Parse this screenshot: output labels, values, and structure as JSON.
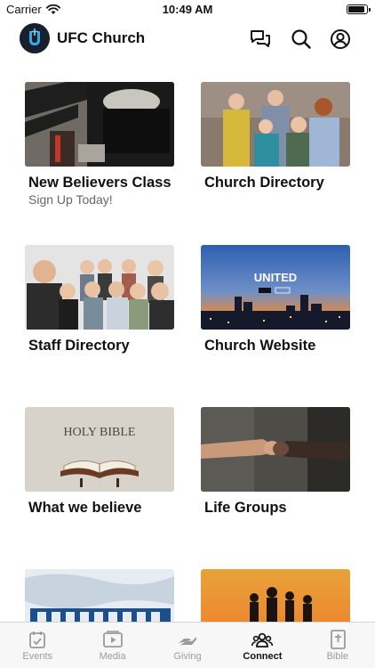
{
  "status": {
    "carrier": "Carrier",
    "time": "10:49 AM",
    "battery_level": 0.95
  },
  "header": {
    "title": "UFC Church"
  },
  "cards": [
    {
      "title": "New Believers Class",
      "subtitle": "Sign Up Today!"
    },
    {
      "title": "Church Directory"
    },
    {
      "title": "Staff Directory"
    },
    {
      "title": "Church Website",
      "image_text": "UNITED"
    },
    {
      "title": "What we believe",
      "image_text": "HOLY BIBLE"
    },
    {
      "title": "Life Groups"
    },
    {
      "title": ""
    },
    {
      "title": ""
    }
  ],
  "tabs": [
    {
      "label": "Events",
      "icon": "calendar-check-icon"
    },
    {
      "label": "Media",
      "icon": "play-icon"
    },
    {
      "label": "Giving",
      "icon": "giving-hand-icon"
    },
    {
      "label": "Connect",
      "icon": "people-icon",
      "active": true
    },
    {
      "label": "Bible",
      "icon": "bible-icon"
    }
  ]
}
